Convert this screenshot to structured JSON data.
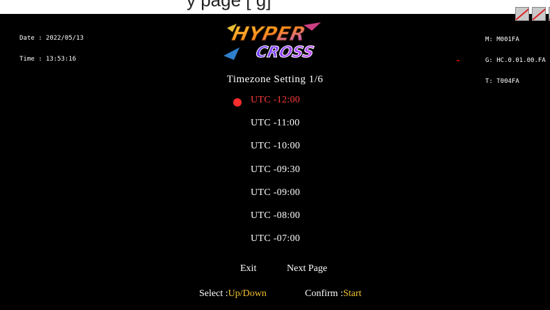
{
  "top_caption": "y           page   [                     g]",
  "info_left": {
    "date": "Date : 2022/05/13",
    "time": "Time : 13:53:16"
  },
  "info_right": {
    "m": "M: M001FA",
    "g": "G: HC.0.01.00.FA",
    "t": "T: T004FA"
  },
  "logo": {
    "line1": "HYPER",
    "line2": "CROSS"
  },
  "title": "Timezone Setting 1/6",
  "timezones": [
    {
      "label": "UTC -12:00",
      "selected": true
    },
    {
      "label": "UTC -11:00",
      "selected": false
    },
    {
      "label": "UTC -10:00",
      "selected": false
    },
    {
      "label": "UTC -09:30",
      "selected": false
    },
    {
      "label": "UTC -09:00",
      "selected": false
    },
    {
      "label": "UTC -08:00",
      "selected": false
    },
    {
      "label": "UTC -07:00",
      "selected": false
    }
  ],
  "nav": {
    "exit": "Exit",
    "next_page": "Next Page"
  },
  "hints": {
    "select_key": "Select :",
    "select_val": "Up/Down",
    "confirm_key": "Confirm :",
    "confirm_val": "Start"
  },
  "colors": {
    "background": "#000000",
    "text": "#ffffff",
    "selected": "#ff3b3b",
    "hint_value": "#f2c232"
  },
  "icons": [
    "status-icon-1",
    "status-icon-2",
    "status-icon-3"
  ]
}
